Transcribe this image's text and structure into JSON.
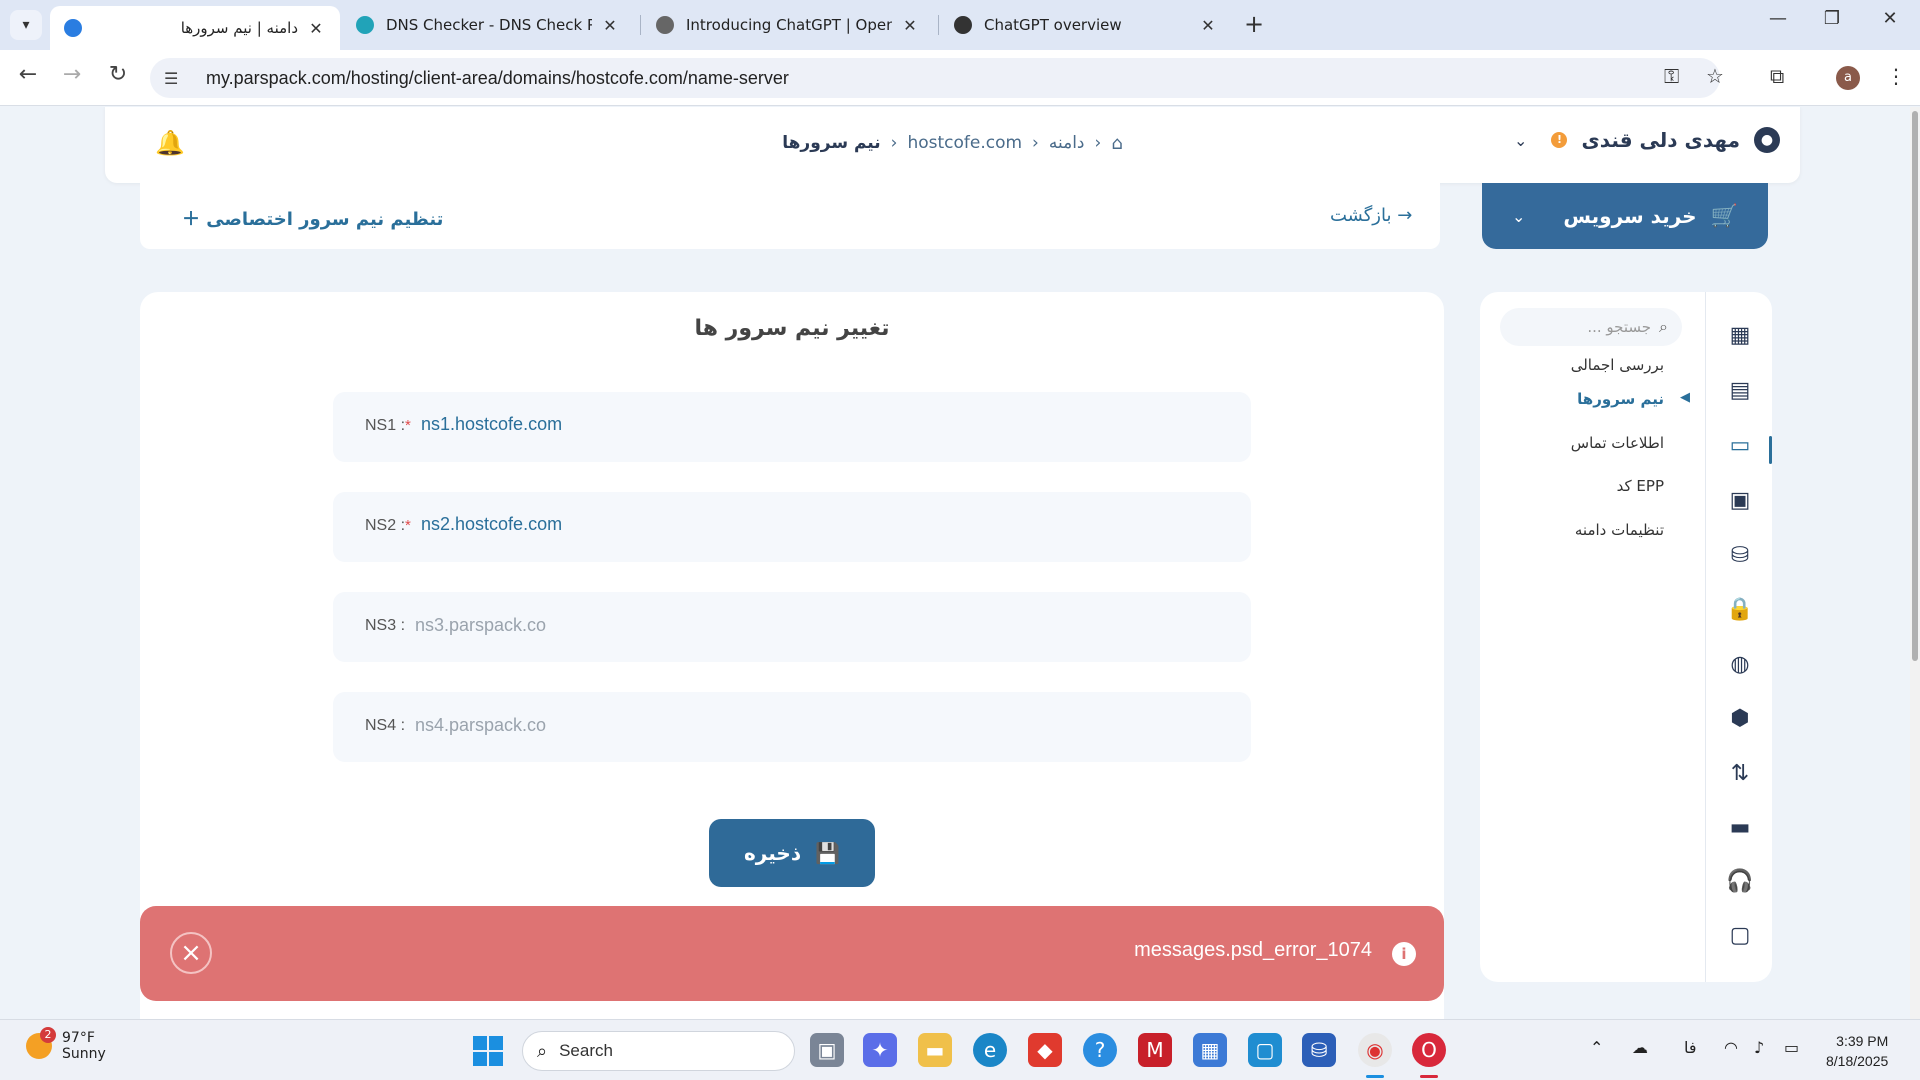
{
  "browser": {
    "tabs": [
      {
        "title": "دامنه | نیم سرورها",
        "active": true
      },
      {
        "title": "DNS Checker - DNS Check Prop",
        "active": false
      },
      {
        "title": "Introducing ChatGPT | OpenAI",
        "active": false
      },
      {
        "title": "ChatGPT overview",
        "active": false
      }
    ],
    "url": "my.parspack.com/hosting/client-area/domains/hostcofe.com/name-server",
    "profile_initial": "a"
  },
  "header": {
    "user_name": "مهدی دلی قندی",
    "breadcrumb": {
      "home_icon": "home-icon",
      "domain": "دامنه",
      "site": "hostcofe.com",
      "current": "نیم سرورها"
    }
  },
  "subbar": {
    "custom_ns_label": "تنظیم نیم سرور اختصاصی",
    "back_label": "بازگشت",
    "buy_label": "خرید سرویس"
  },
  "form": {
    "title": "تغییر نیم سرور ها",
    "rows": [
      {
        "label": "NS1",
        "required": true,
        "value": "ns1.hostcofe.com"
      },
      {
        "label": "NS2",
        "required": true,
        "value": "ns2.hostcofe.com"
      },
      {
        "label": "NS3",
        "required": false,
        "placeholder": "ns3.parspack.co"
      },
      {
        "label": "NS4",
        "required": false,
        "placeholder": "ns4.parspack.co"
      }
    ],
    "save_label": "ذخیره"
  },
  "toast": {
    "message": "messages.psd_error_1074",
    "color": "#de7373"
  },
  "sidebar": {
    "search_placeholder": "جستجو ...",
    "items": [
      {
        "label": "بررسی اجمالی"
      },
      {
        "label": "نیم سرورها",
        "active": true
      },
      {
        "label": "اطلاعات تماس"
      },
      {
        "label": "EPP کد"
      },
      {
        "label": "تنظیمات دامنه"
      }
    ]
  },
  "taskbar": {
    "weather_temp": "97°F",
    "weather_desc": "Sunny",
    "weather_badge": "2",
    "search_placeholder": "Search",
    "lang": "فا",
    "time": "3:39 PM",
    "date": "8/18/2025"
  },
  "colors": {
    "accent": "#2a6f9a",
    "buy_button": "#356a9b",
    "error": "#de7373"
  }
}
